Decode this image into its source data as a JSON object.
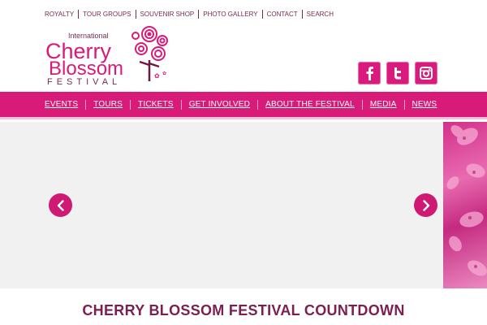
{
  "top_nav": {
    "items": [
      "ROYALTY",
      "TOUR GROUPS",
      "SOUVENIR SHOP",
      "PHOTO GALLERY",
      "CONTACT",
      "SEARCH"
    ]
  },
  "logo": {
    "line1": "International",
    "line2": "Cherry",
    "line3": "Blossom",
    "line4": "FESTIVAL"
  },
  "social": {
    "facebook_icon": "facebook-icon",
    "twitter_icon": "twitter-icon",
    "instagram_icon": "instagram-icon"
  },
  "main_nav": {
    "items": [
      "EVENTS",
      "TOURS",
      "TICKETS",
      "GET INVOLVED",
      "ABOUT THE FESTIVAL",
      "MEDIA",
      "NEWS"
    ]
  },
  "slider": {
    "prev_icon": "chevron-left-icon",
    "next_icon": "chevron-right-icon"
  },
  "countdown": {
    "title": "CHERRY BLOSSOM FESTIVAL COUNTDOWN"
  },
  "colors": {
    "brand_pink": "#d81b78",
    "text_maroon": "#7a2a52",
    "slider_bg": "#f1f1f1"
  }
}
